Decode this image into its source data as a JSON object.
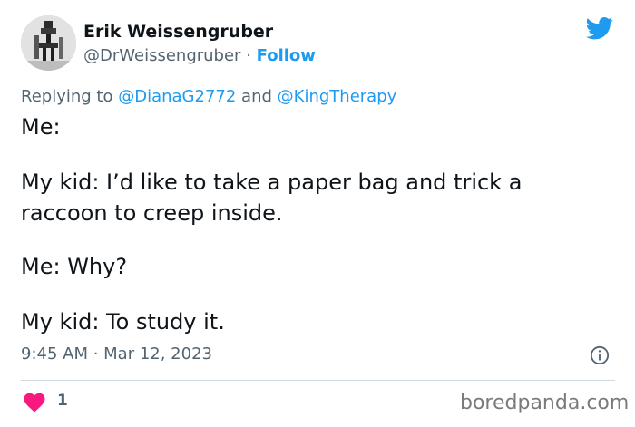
{
  "author": {
    "name": "Erik Weissengruber",
    "handle": "@DrWeissengruber",
    "separator": "·",
    "follow_label": "Follow"
  },
  "reply": {
    "prefix": "Replying to",
    "mention_1": "@DianaG2772",
    "conjunction": "and",
    "mention_2": "@KingTherapy"
  },
  "tweet": {
    "lines": [
      "Me:",
      "My kid: I’d like to take a paper bag and trick a",
      "raccoon to creep inside.",
      "Me: Why?",
      "My kid: To study it."
    ]
  },
  "meta": {
    "timestamp": "9:45 AM · Mar 12, 2023",
    "like_count": "1"
  },
  "watermark": "boredpanda.com",
  "icons": {
    "logo": "twitter-bird-icon",
    "info": "info-icon",
    "like": "heart-icon"
  },
  "colors": {
    "accent": "#1d9bf0",
    "heart": "#f91880",
    "secondary_text": "#536471",
    "primary_text": "#0f1419"
  }
}
